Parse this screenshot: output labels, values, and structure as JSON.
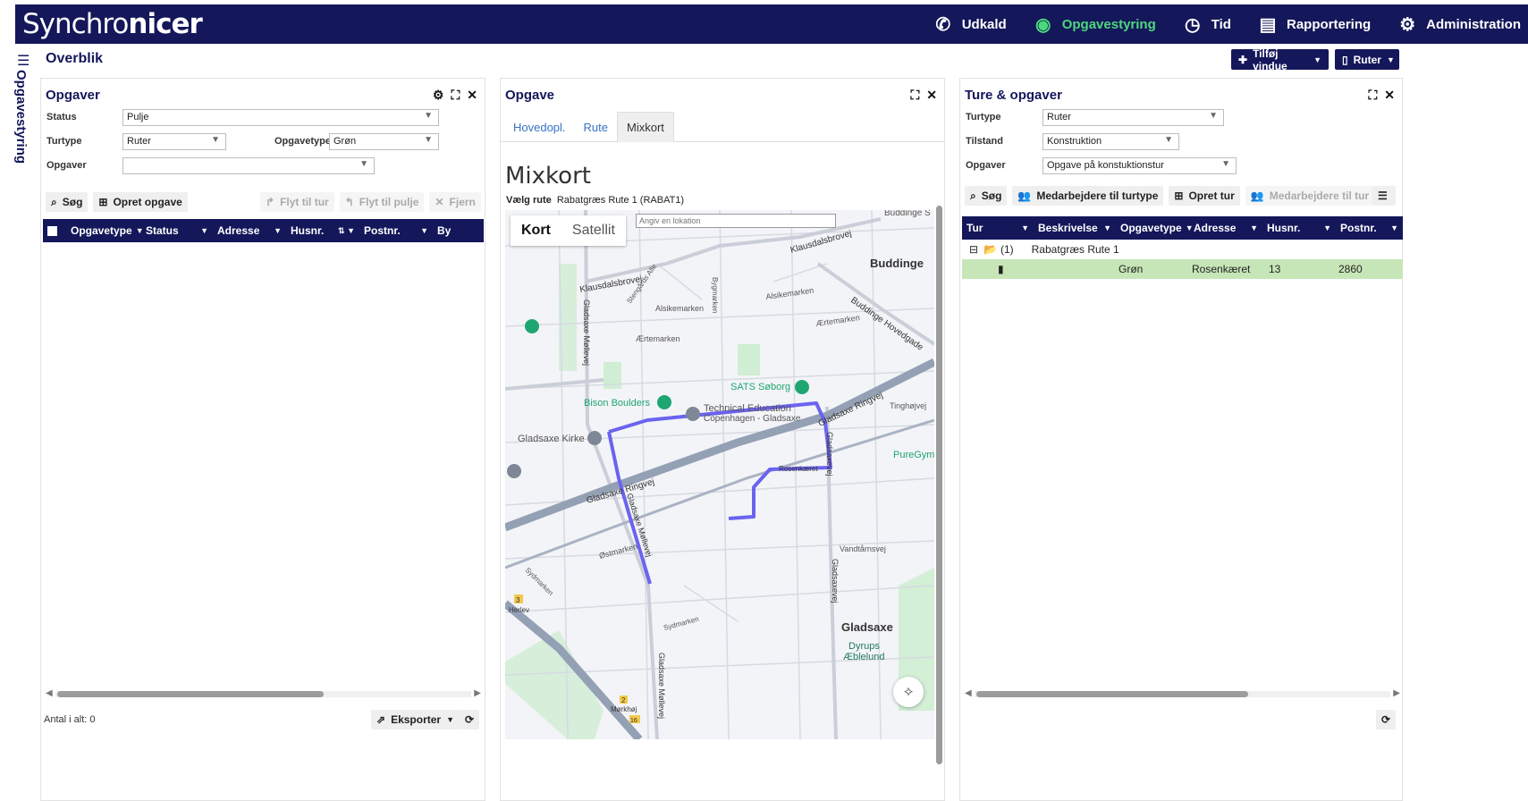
{
  "brand": {
    "prefix": "Synchro",
    "suffix": "nicer"
  },
  "nav": [
    {
      "label": "Udkald",
      "icon": "phone-icon"
    },
    {
      "label": "Opgavestyring",
      "icon": "globe-icon",
      "active": true
    },
    {
      "label": "Tid",
      "icon": "clock-icon"
    },
    {
      "label": "Rapportering",
      "icon": "report-icon"
    },
    {
      "label": "Administration",
      "icon": "gears-icon"
    }
  ],
  "sidebar": {
    "label": "Opgavestyring"
  },
  "header": {
    "title": "Overblik",
    "add_window": "Tilføj vindue",
    "routes": "Ruter"
  },
  "opgaver_panel": {
    "title": "Opgaver",
    "status_label": "Status",
    "status_value": "Pulje",
    "turtype_label": "Turtype",
    "turtype_value": "Ruter",
    "opgavetype_label": "Opgavetype",
    "opgavetype_value": "Grøn",
    "opgaver_label": "Opgaver",
    "opgaver_value": "",
    "buttons": {
      "search": "Søg",
      "create": "Opret opgave",
      "move_trip": "Flyt til tur",
      "move_pool": "Flyt til pulje",
      "remove": "Fjern"
    },
    "columns": [
      "Opgavetype",
      "Status",
      "Adresse",
      "Husnr.",
      "Postnr.",
      "By"
    ],
    "total": "Antal i alt: 0",
    "export": "Eksporter"
  },
  "opgave_panel": {
    "title": "Opgave",
    "tabs": [
      "Hovedopl.",
      "Rute",
      "Mixkort"
    ],
    "heading": "Mixkort",
    "route_label": "Vælg rute",
    "route_value": "Rabatgræs Rute 1 (RABAT1)",
    "map": {
      "tab_map": "Kort",
      "tab_satellite": "Satellit",
      "search_placeholder": "Angiv en lokation",
      "labels": {
        "buddinge": "Buddinge",
        "buddinge_s": "Buddinge S",
        "klausdalsbrovej1": "Klausdalsbrovej",
        "klausdalsbrovej2": "Klausdalsbrovej",
        "alsikemarken1": "Alsikemarken",
        "alsikemarken2": "Alsikemarken",
        "aertemarken1": "Ærtemarken",
        "aertemarken2": "Ærtemarken",
        "bygmarken": "Bygmarken",
        "stengaards": "Stengårds Alle",
        "buddinge_hovedgade": "Buddinge Hovedgade",
        "sats": "SATS Søborg",
        "bison": "Bison Boulders",
        "tec1": "Technical Education",
        "tec2": "Copenhagen - Gladsaxe",
        "kirke": "Gladsaxe Kirke",
        "ringvej1": "Gladsaxe Ringvej",
        "ringvej2": "Gladsaxe Ringvej",
        "tinghojvej": "Tinghøjvej",
        "puregym": "PureGym",
        "rosenkaeret": "Rosenkæret",
        "gladsaxevej1": "Gladsaxevej",
        "gladsaxevej2": "Gladsaxevej",
        "mollevej1": "Gladsaxe Møllevej",
        "mollevej2": "Gladsaxe Møllevej",
        "mollevej3": "Gladsaxe Møllevej",
        "ostmarken": "Østmarken",
        "sydmarken1": "Sydmarken",
        "sydmarken2": "Sydmarken",
        "vandtaarnsvej": "Vandtårnsvej",
        "gladsaxe": "Gladsaxe",
        "dyrups1": "Dyrups",
        "dyrups2": "Æblelund",
        "herlev": "Herlev",
        "herlev_num": "3",
        "morkhoj": "Mørkhøj",
        "morkhoj_num": "2",
        "morkhoj_num2": "16"
      }
    }
  },
  "ture_panel": {
    "title": "Ture & opgaver",
    "turtype_label": "Turtype",
    "turtype_value": "Ruter",
    "tilstand_label": "Tilstand",
    "tilstand_value": "Konstruktion",
    "opgaver_label": "Opgaver",
    "opgaver_value": "Opgave på konstuktionstur",
    "buttons": {
      "search": "Søg",
      "emp_type": "Medarbejdere til turtype",
      "create_trip": "Opret tur",
      "emp_trip": "Medarbejdere til tur"
    },
    "columns": [
      "Tur",
      "Beskrivelse",
      "Opgavetype",
      "Adresse",
      "Husnr.",
      "Postnr."
    ],
    "group": {
      "count": "(1)",
      "name": "Rabatgræs Rute 1"
    },
    "row": {
      "opgavetype": "Grøn",
      "adresse": "Rosenkæret",
      "husnr": "13",
      "postnr": "2860"
    }
  },
  "colors": {
    "navy": "#14175a",
    "active_green": "#4cd97b",
    "route": "#6b63f0",
    "selected_row": "#c7e6b7"
  }
}
